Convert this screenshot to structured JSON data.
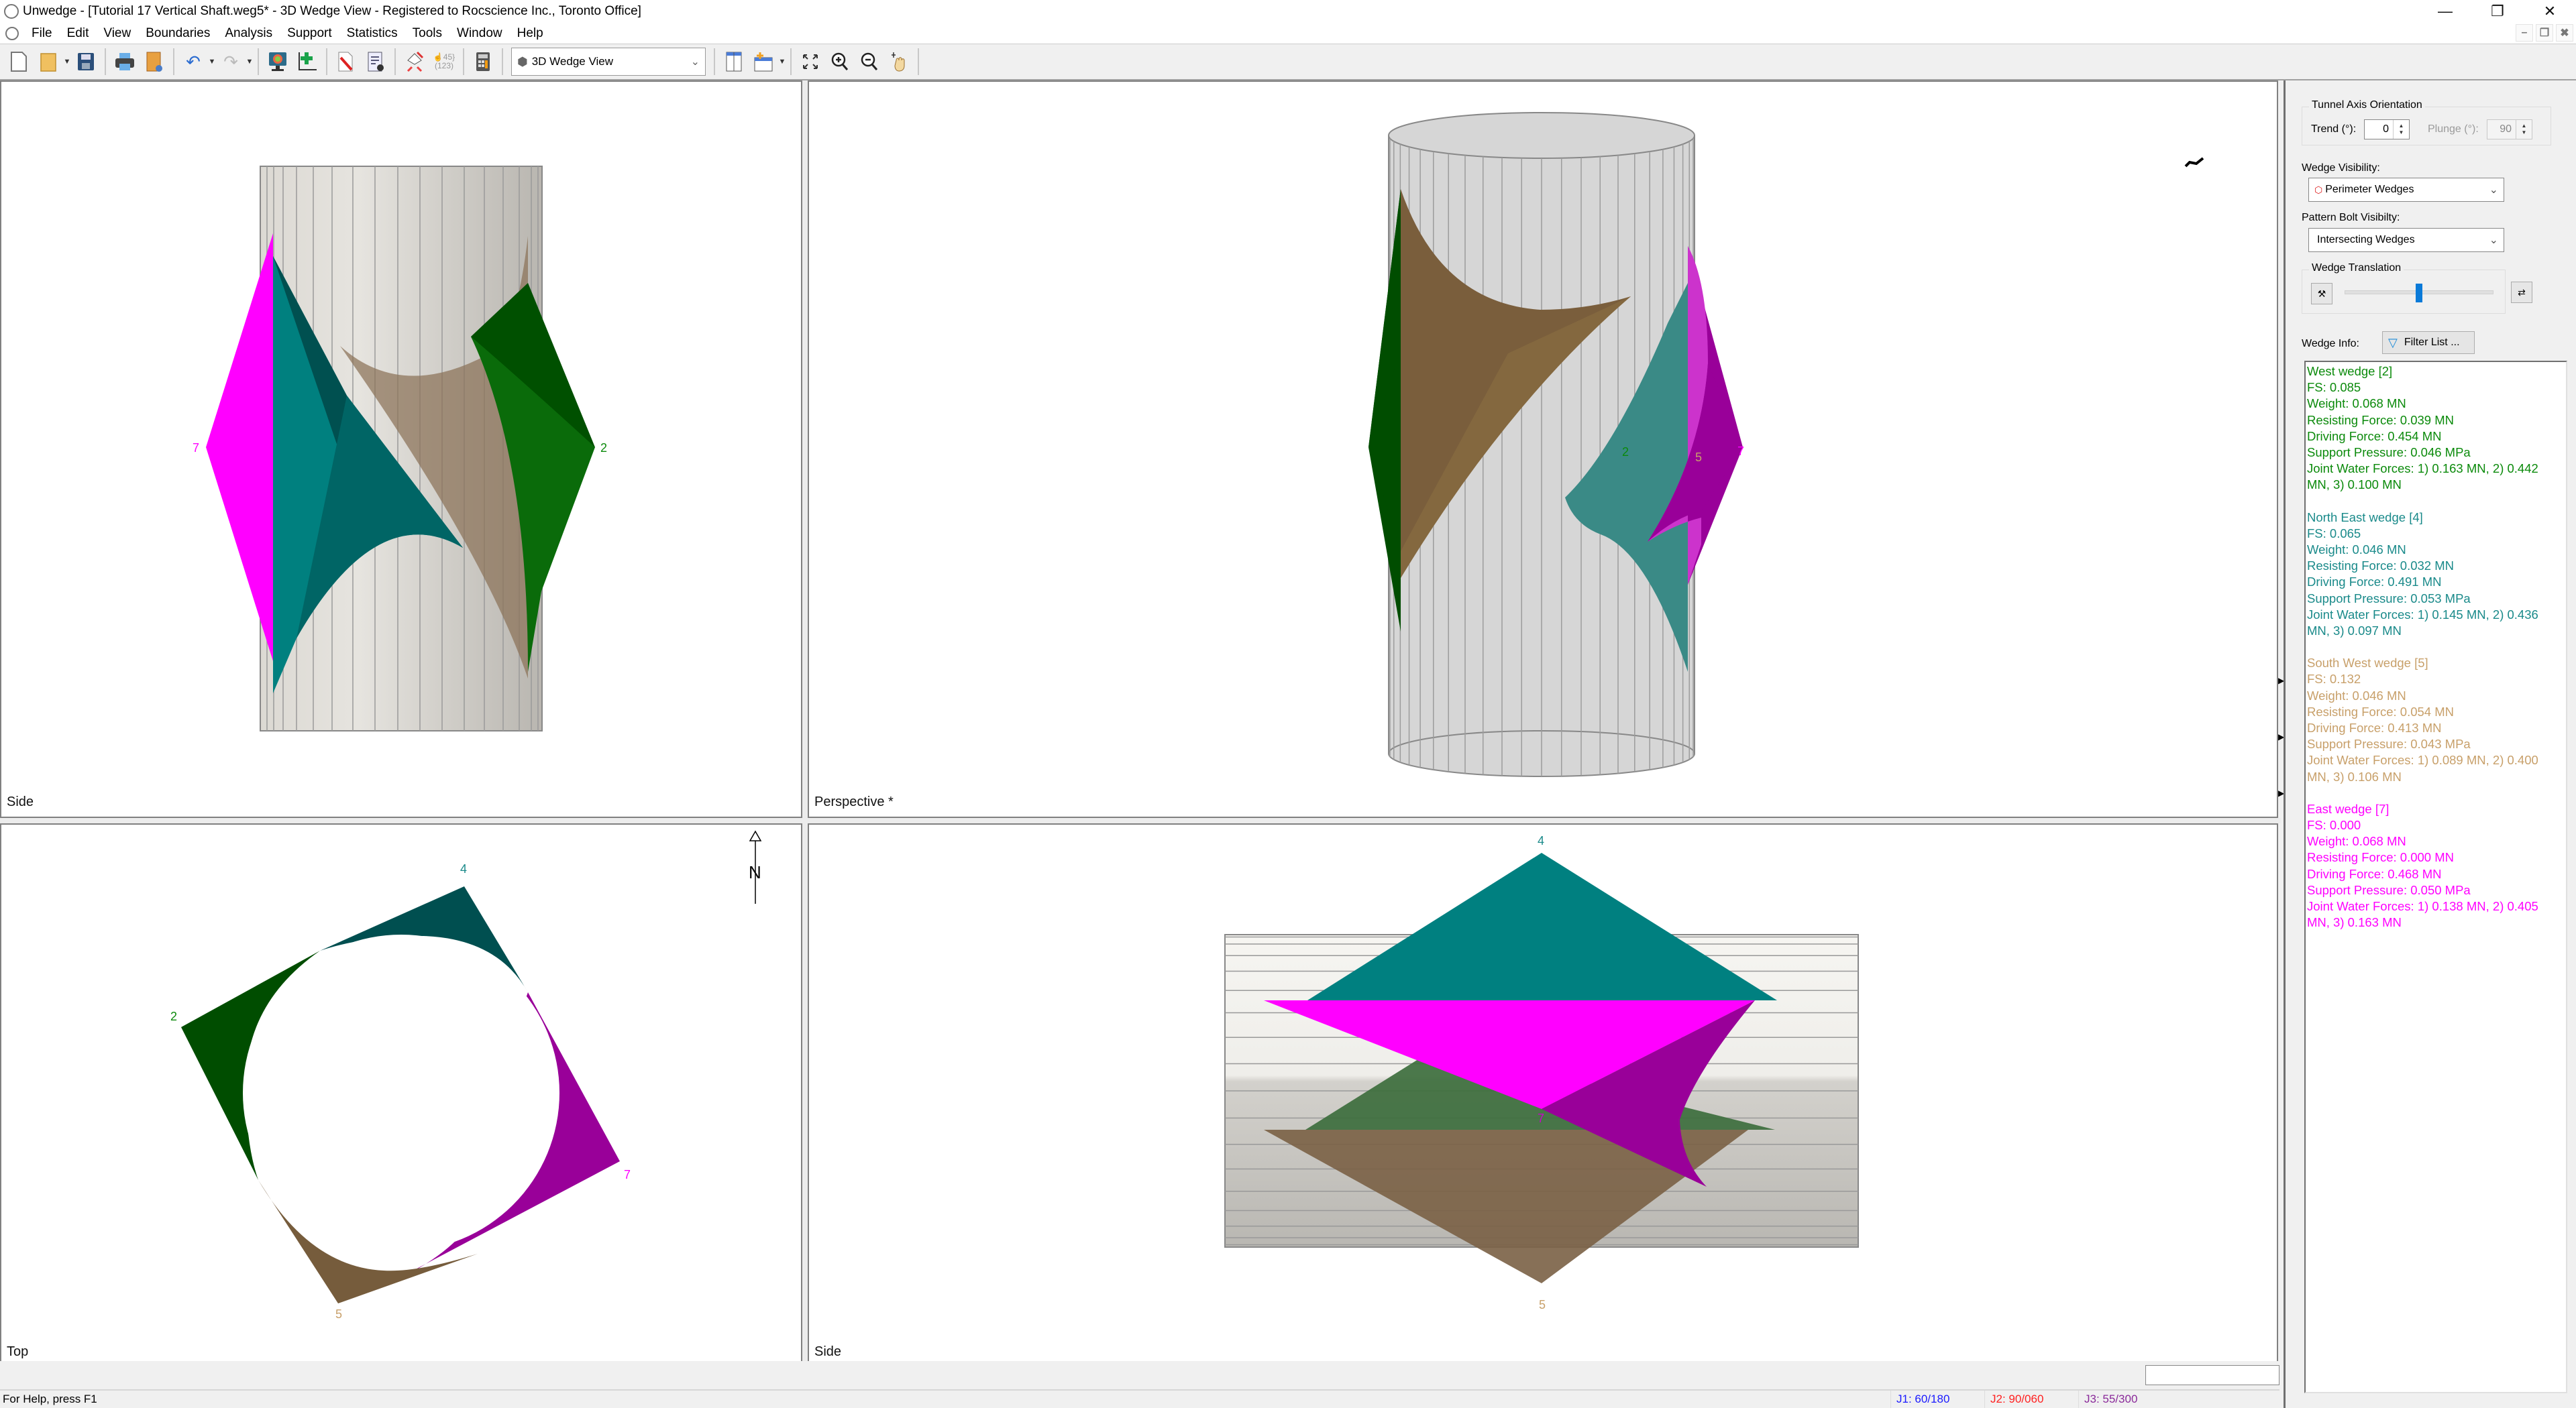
{
  "window": {
    "title": "Unwedge - [Tutorial 17 Vertical Shaft.weg5* - 3D Wedge View - Registered to Rocscience Inc., Toronto Office]",
    "controls": [
      "minimize",
      "restore",
      "close"
    ]
  },
  "menu": [
    "File",
    "Edit",
    "View",
    "Boundaries",
    "Analysis",
    "Support",
    "Statistics",
    "Tools",
    "Window",
    "Help"
  ],
  "toolbar": {
    "buttons": [
      "new-file",
      "open-folder",
      "save",
      "print",
      "export",
      "undo",
      "redo",
      "display-options",
      "add-joint",
      "edit-input",
      "project-settings",
      "compute",
      "number-labels",
      "calculator"
    ],
    "number_label_icon_text": "{45}(123)",
    "view_selector": "3D Wedge View",
    "right_buttons": [
      "tile-vertical",
      "new-view",
      "zoom-extents",
      "zoom-in",
      "zoom-out",
      "pan"
    ]
  },
  "views": {
    "top_left": {
      "label": "Side"
    },
    "top_right": {
      "label": "Perspective *"
    },
    "bottom_left": {
      "label": "Top",
      "north_arrow": "N"
    },
    "bottom_right": {
      "label": "Side"
    }
  },
  "wedge_labels": {
    "w2": "2",
    "w4": "4",
    "w5": "5",
    "w7": "7"
  },
  "colors": {
    "west_wedge": "#0b8a0b",
    "north_east_wedge": "#1a8a8a",
    "south_west_wedge": "#c8a06a",
    "east_wedge": "#ff00ff",
    "j1": "#1a1aff",
    "j2": "#ff2020",
    "j3": "#8a2a9a"
  },
  "side_panel": {
    "tunnel_axis": {
      "title": "Tunnel Axis Orientation",
      "trend_label": "Trend (°):",
      "trend_value": "0",
      "plunge_label": "Plunge (°):",
      "plunge_value": "90"
    },
    "wedge_visibility": {
      "label": "Wedge Visibility:",
      "value": "Perimeter Wedges"
    },
    "pattern_bolt_visibility": {
      "label": "Pattern Bolt Visibilty:",
      "value": "Intersecting Wedges"
    },
    "wedge_translation": {
      "title": "Wedge Translation",
      "slider_fraction": 0.5
    },
    "wedge_info": {
      "label": "Wedge Info:",
      "filter_button": "Filter List ...",
      "wedges": [
        {
          "name": "West wedge [2]",
          "color": "#0b8a0b",
          "lines": [
            "FS: 0.085",
            "Weight: 0.068 MN",
            "Resisting Force: 0.039 MN",
            "Driving Force: 0.454 MN",
            "Support Pressure: 0.046 MPa",
            "Joint Water Forces: 1) 0.163 MN,  2) 0.442",
            "MN,  3) 0.100 MN"
          ]
        },
        {
          "name": "North East wedge [4]",
          "color": "#1a8a8a",
          "lines": [
            "FS: 0.065",
            "Weight: 0.046 MN",
            "Resisting Force: 0.032 MN",
            "Driving Force: 0.491 MN",
            "Support Pressure: 0.053 MPa",
            "Joint Water Forces: 1) 0.145 MN,  2) 0.436",
            "MN,  3) 0.097 MN"
          ]
        },
        {
          "name": "South West wedge [5]",
          "color": "#c8a06a",
          "lines": [
            "FS: 0.132",
            "Weight: 0.046 MN",
            "Resisting Force: 0.054 MN",
            "Driving Force: 0.413 MN",
            "Support Pressure: 0.043 MPa",
            "Joint Water Forces: 1) 0.089 MN,  2) 0.400",
            "MN,  3) 0.106 MN"
          ]
        },
        {
          "name": "East wedge [7]",
          "color": "#ff00ff",
          "lines": [
            "FS: 0.000",
            "Weight: 0.068 MN",
            "Resisting Force: 0.000 MN",
            "Driving Force: 0.468 MN",
            "Support Pressure: 0.050 MPa",
            "Joint Water Forces: 1) 0.138 MN,  2) 0.405",
            "MN,  3) 0.163 MN"
          ]
        }
      ]
    }
  },
  "status": {
    "help": "For Help, press F1",
    "j1": "J1: 60/180",
    "j2": "J2: 90/060",
    "j3": "J3: 55/300"
  }
}
